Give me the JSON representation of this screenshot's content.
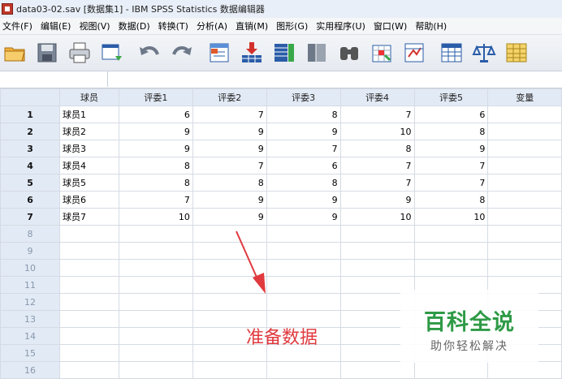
{
  "window": {
    "title": "data03-02.sav [数据集1] - IBM SPSS Statistics 数据编辑器"
  },
  "menu": [
    {
      "label": "文件(F)"
    },
    {
      "label": "编辑(E)"
    },
    {
      "label": "视图(V)"
    },
    {
      "label": "数据(D)"
    },
    {
      "label": "转换(T)"
    },
    {
      "label": "分析(A)"
    },
    {
      "label": "直销(M)"
    },
    {
      "label": "图形(G)"
    },
    {
      "label": "实用程序(U)"
    },
    {
      "label": "窗口(W)"
    },
    {
      "label": "帮助(H)"
    }
  ],
  "toolbar": {
    "icons": [
      "open-folder-icon",
      "save-icon",
      "print-icon",
      "dialog-recall-icon",
      "undo-icon",
      "redo-icon",
      "goto-case-icon",
      "goto-variable-icon",
      "variables-icon",
      "split-file-icon",
      "find-icon",
      "insert-cases-icon",
      "weight-cases-icon",
      "value-labels-icon",
      "scale-icon",
      "use-sets-icon"
    ]
  },
  "grid": {
    "columns": [
      "球员",
      "评委1",
      "评委2",
      "评委3",
      "评委4",
      "评委5",
      "变量"
    ],
    "rows": [
      {
        "num": "1",
        "cells": [
          "球员1",
          "6",
          "7",
          "8",
          "7",
          "6",
          ""
        ]
      },
      {
        "num": "2",
        "cells": [
          "球员2",
          "9",
          "9",
          "9",
          "10",
          "8",
          ""
        ]
      },
      {
        "num": "3",
        "cells": [
          "球员3",
          "9",
          "9",
          "7",
          "8",
          "9",
          ""
        ]
      },
      {
        "num": "4",
        "cells": [
          "球员4",
          "8",
          "7",
          "6",
          "7",
          "7",
          ""
        ]
      },
      {
        "num": "5",
        "cells": [
          "球员5",
          "8",
          "8",
          "8",
          "7",
          "7",
          ""
        ]
      },
      {
        "num": "6",
        "cells": [
          "球员6",
          "7",
          "9",
          "9",
          "9",
          "8",
          ""
        ]
      },
      {
        "num": "7",
        "cells": [
          "球员7",
          "10",
          "9",
          "9",
          "10",
          "10",
          ""
        ]
      },
      {
        "num": "8",
        "cells": [
          "",
          "",
          "",
          "",
          "",
          "",
          ""
        ]
      },
      {
        "num": "9",
        "cells": [
          "",
          "",
          "",
          "",
          "",
          "",
          ""
        ]
      },
      {
        "num": "10",
        "cells": [
          "",
          "",
          "",
          "",
          "",
          "",
          ""
        ]
      },
      {
        "num": "11",
        "cells": [
          "",
          "",
          "",
          "",
          "",
          "",
          ""
        ]
      },
      {
        "num": "12",
        "cells": [
          "",
          "",
          "",
          "",
          "",
          "",
          ""
        ]
      },
      {
        "num": "13",
        "cells": [
          "",
          "",
          "",
          "",
          "",
          "",
          ""
        ]
      },
      {
        "num": "14",
        "cells": [
          "",
          "",
          "",
          "",
          "",
          "",
          ""
        ]
      },
      {
        "num": "15",
        "cells": [
          "",
          "",
          "",
          "",
          "",
          "",
          ""
        ]
      },
      {
        "num": "16",
        "cells": [
          "",
          "",
          "",
          "",
          "",
          "",
          ""
        ]
      }
    ]
  },
  "annotation": {
    "text": "准备数据",
    "color": "#e0393e"
  },
  "watermark": {
    "main": "百科全说",
    "sub": "助你轻松解决"
  }
}
